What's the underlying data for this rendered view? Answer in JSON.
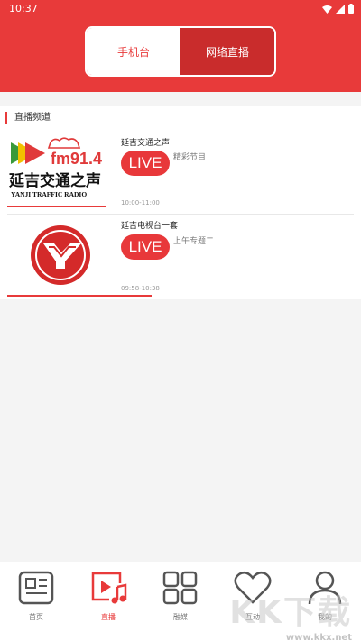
{
  "status": {
    "time": "10:37"
  },
  "header": {
    "tabs": [
      {
        "label": "手机台"
      },
      {
        "label": "网络直播"
      }
    ]
  },
  "section": {
    "title": "直播频道"
  },
  "channels": [
    {
      "name": "延吉交通之声",
      "live": "LIVE",
      "program": "精彩节目",
      "time": "10:00-11:00",
      "progress": 0.55,
      "logo_text": "fm91.4",
      "logo_cn": "延吉交通之声",
      "logo_en": "YANJI TRAFFIC RADIO"
    },
    {
      "name": "延吉电视台一套",
      "live": "LIVE",
      "program": "上午专题二",
      "time": "09:58-10:38",
      "progress": 0.8
    }
  ],
  "tabbar": {
    "items": [
      {
        "label": "首页",
        "icon": "news-icon"
      },
      {
        "label": "直播",
        "icon": "live-tv-icon"
      },
      {
        "label": "融媒",
        "icon": "grid-icon"
      },
      {
        "label": "互动",
        "icon": "heart-icon"
      },
      {
        "label": "我的",
        "icon": "user-icon"
      }
    ]
  },
  "watermark": {
    "text": "KK下载",
    "url": "www.kkx.net"
  },
  "colors": {
    "accent": "#e83a3a"
  }
}
